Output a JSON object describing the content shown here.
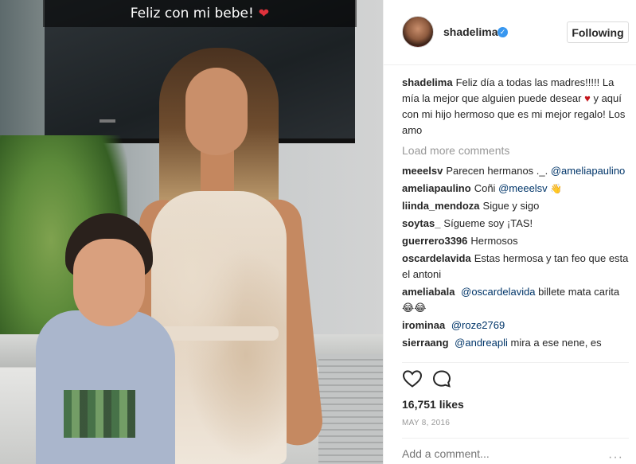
{
  "photo": {
    "caption": "Feliz con mi bebe!",
    "caption_emoji": "❤"
  },
  "header": {
    "username": "shadelima",
    "verified_icon": "verified-badge-icon",
    "follow_label": "Following"
  },
  "post_caption": {
    "user": "shadelima",
    "text_1": "Feliz día a todas las madres!!!!! La mía la mejor que alguien puede desear",
    "heart": "♥",
    "text_2": "y aquí con mi hijo hermoso que es mi mejor regalo! Los amo"
  },
  "load_more": "Load more comments",
  "comments": [
    {
      "user": "meeelsv",
      "text": "Parecen hermanos ._.",
      "mention": "@ameliapaulino",
      "after": ""
    },
    {
      "user": "ameliapaulino",
      "text": "Coñi",
      "mention": "@meeelsv",
      "after": "👋"
    },
    {
      "user": "liinda_mendoza",
      "text": "Sigue y sigo",
      "mention": "",
      "after": ""
    },
    {
      "user": "soytas_",
      "text": "Sígueme soy ¡TAS!",
      "mention": "",
      "after": ""
    },
    {
      "user": "guerrero3396",
      "text": "Hermosos",
      "mention": "",
      "after": ""
    },
    {
      "user": "oscardelavida",
      "text": "Estas hermosa y tan feo que esta el antoni",
      "mention": "",
      "after": ""
    },
    {
      "user": "ameliabala",
      "text": "",
      "mention": "@oscardelavida",
      "after": "billete mata carita 😂😂"
    },
    {
      "user": "irominaa",
      "text": "",
      "mention": "@roze2769",
      "after": ""
    },
    {
      "user": "sierraang",
      "text": "",
      "mention": "@andreapli",
      "after": "mira a ese nene, es"
    }
  ],
  "likes": "16,751 likes",
  "date": "MAY 8, 2016",
  "add_comment_placeholder": "Add a comment...",
  "more_icon": "···",
  "colors": {
    "link": "#003569",
    "verified": "#3897f0",
    "muted": "#999999",
    "heart": "#c4161c"
  }
}
